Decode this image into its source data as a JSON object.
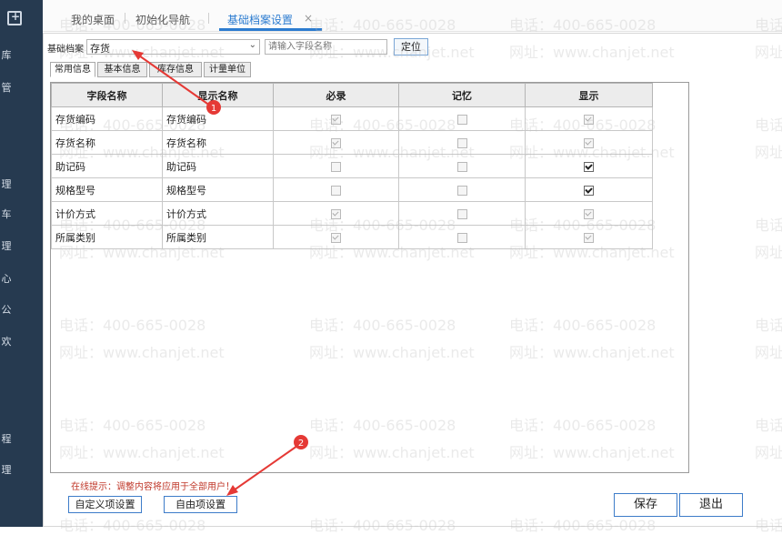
{
  "sidebar": {
    "items": [
      "库",
      "管",
      "理",
      "车",
      "理",
      "心",
      "公",
      "欢",
      "程",
      "理"
    ]
  },
  "tabs": [
    "我的桌面",
    "初始化导航",
    "基础档案设置"
  ],
  "tab_close_icon": "×",
  "form": {
    "base_label": "基础档案",
    "base_value": "存货",
    "search_placeholder": "请输入字段名称",
    "locate_button": "定位"
  },
  "subtabs": [
    "常用信息",
    "基本信息",
    "库存信息",
    "计量单位"
  ],
  "table": {
    "headers": [
      "字段名称",
      "显示名称",
      "必录",
      "记忆",
      "显示"
    ],
    "rows": [
      {
        "field": "存货编码",
        "display": "存货编码",
        "required": "checked-disabled",
        "memory": "unchecked-disabled",
        "show": "checked-disabled"
      },
      {
        "field": "存货名称",
        "display": "存货名称",
        "required": "checked-disabled",
        "memory": "unchecked-disabled",
        "show": "checked-disabled"
      },
      {
        "field": "助记码",
        "display": "助记码",
        "required": "unchecked-disabled",
        "memory": "unchecked-disabled",
        "show": "checked"
      },
      {
        "field": "规格型号",
        "display": "规格型号",
        "required": "unchecked-disabled",
        "memory": "unchecked-disabled",
        "show": "checked"
      },
      {
        "field": "计价方式",
        "display": "计价方式",
        "required": "checked-disabled",
        "memory": "unchecked-disabled",
        "show": "checked-disabled"
      },
      {
        "field": "所属类别",
        "display": "所属类别",
        "required": "checked-disabled",
        "memory": "unchecked-disabled",
        "show": "checked-disabled"
      }
    ]
  },
  "tip": "在线提示：调整内容将应用于全部用户！",
  "buttons": {
    "custom": "自定义项设置",
    "free": "自由项设置",
    "save": "保存",
    "exit": "退出"
  },
  "annotations": [
    "1",
    "2"
  ],
  "watermark": {
    "phone": "电话：400-665-0028",
    "site": "网址：www.chanjet.net"
  },
  "colors": {
    "accent": "#2c7cd0",
    "annotation": "#e53935",
    "tip": "#c0392b",
    "sidebar": "#263a50"
  }
}
